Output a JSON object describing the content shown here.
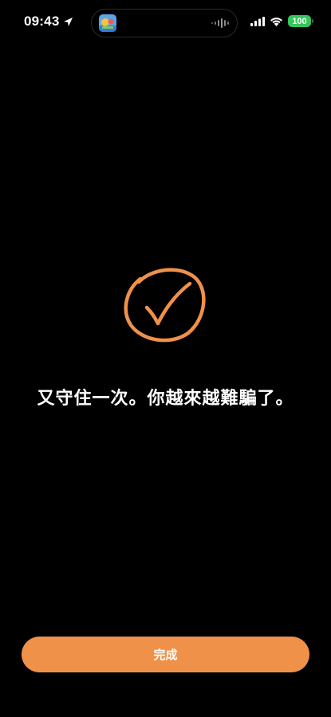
{
  "status_bar": {
    "time": "09:43",
    "battery_level": "100",
    "battery_color": "#34c759",
    "icons": [
      "location-arrow-icon",
      "app-icon",
      "audio-wave-icon",
      "cellular-signal-icon",
      "wifi-icon",
      "battery-icon"
    ]
  },
  "main": {
    "icon": "checkmark-circle-icon",
    "accent_color": "#f0914a",
    "message": "又守住一次。你越來越難騙了。"
  },
  "footer": {
    "done_label": "完成"
  }
}
